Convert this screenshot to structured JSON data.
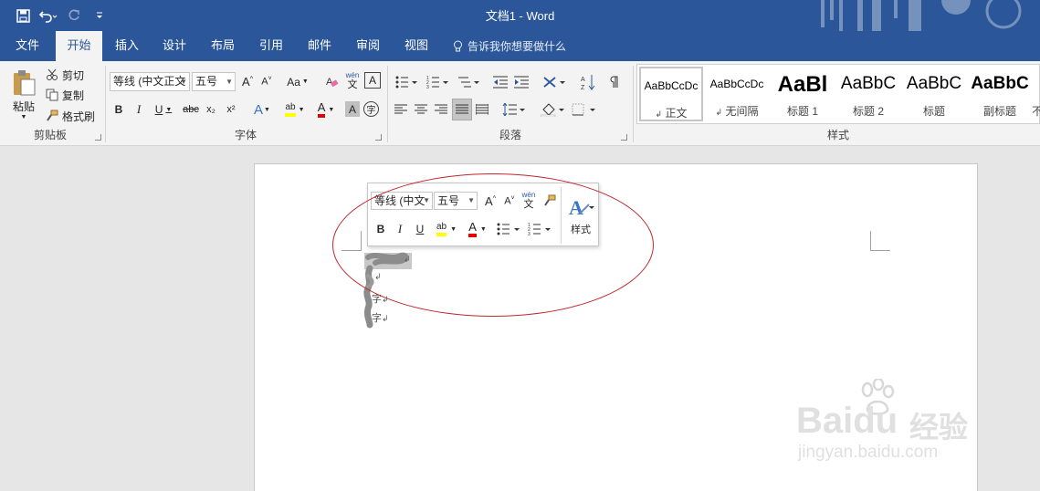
{
  "window": {
    "title": "文档1  -  Word"
  },
  "tabs": [
    {
      "label": "文件"
    },
    {
      "label": "开始"
    },
    {
      "label": "插入"
    },
    {
      "label": "设计"
    },
    {
      "label": "布局"
    },
    {
      "label": "引用"
    },
    {
      "label": "邮件"
    },
    {
      "label": "审阅"
    },
    {
      "label": "视图"
    }
  ],
  "tellme": "告诉我你想要做什么",
  "clipboard": {
    "paste": "粘贴",
    "cut": "剪切",
    "copy": "复制",
    "format_painter": "格式刷",
    "group": "剪贴板"
  },
  "font": {
    "name": "等线 (中文正文",
    "size": "五号",
    "group": "字体",
    "case_label": "Aa",
    "phonetic_label": "wén 文",
    "border_label": "A",
    "bold": "B",
    "italic": "I",
    "underline": "U",
    "strike": "abc",
    "sub": "x₂",
    "sup": "x²",
    "grow": "A^",
    "shrink": "A˅",
    "effects": "A",
    "highlight": "ab",
    "color": "A",
    "shade": "A",
    "circle": "字"
  },
  "paragraph": {
    "group": "段落"
  },
  "styles": {
    "group": "样式",
    "items": [
      {
        "preview": "AaBbCcDc",
        "name": "正文"
      },
      {
        "preview": "AaBbCcDc",
        "name": "无间隔"
      },
      {
        "preview": "AaBl",
        "name": "标题 1"
      },
      {
        "preview": "AaBbC",
        "name": "标题 2"
      },
      {
        "preview": "AaBbC",
        "name": "标题"
      },
      {
        "preview": "AaBbC",
        "name": "副标题"
      },
      {
        "preview": "",
        "name": "不"
      }
    ]
  },
  "mini_toolbar": {
    "font": "等线 (中文",
    "size": "五号",
    "styles_label": "样式",
    "bold": "B",
    "italic": "I",
    "underline": "U"
  },
  "document": {
    "lines": [
      "字",
      "字",
      "字"
    ]
  },
  "watermark": {
    "brand": "Baidu",
    "cn": "经验",
    "url": "jingyan.baidu.com"
  },
  "colors": {
    "accent": "#2b579a",
    "annotation": "#c0262d",
    "highlight": "#ffff00",
    "font_red": "#e00000"
  }
}
